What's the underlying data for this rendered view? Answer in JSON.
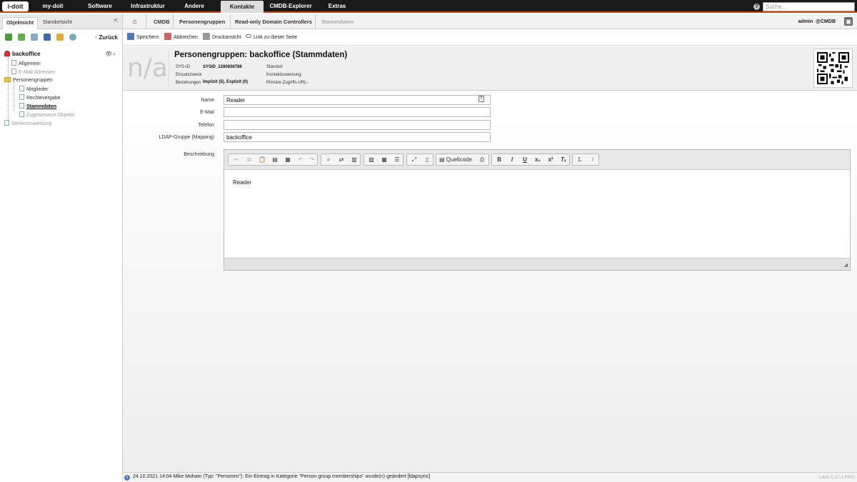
{
  "logo": "i-doit",
  "nav": {
    "items": [
      "my-doit",
      "Software",
      "Infrastruktur",
      "Andere",
      "Kontakte",
      "CMDB-Explorer",
      "Extras"
    ],
    "active": "Kontakte"
  },
  "search": {
    "placeholder": "Suche..."
  },
  "sidebar": {
    "tabs": [
      "Objektsicht",
      "Standortsicht"
    ],
    "back_label": "Zurück",
    "tree": {
      "root": "backoffice",
      "items": [
        "Allgemein",
        "E-Mail Adressen",
        "Personengruppen",
        "Mitglieder",
        "Rechtevergabe",
        "Stammdaten",
        "Zugewiesene Objekte",
        "Servicezuweisung"
      ]
    }
  },
  "breadcrumb": {
    "items": [
      "CMDB",
      "Personengruppen",
      "Read-only Domain Controllers",
      "Stammdaten"
    ]
  },
  "user": {
    "name": "admin",
    "tenant": "@CMDB"
  },
  "actions": [
    "Speichern",
    "Abbrechen",
    "Druckansicht",
    "Link zu dieser Seite"
  ],
  "header": {
    "image_placeholder": "n/a",
    "title": "Personengruppen: backoffice (Stammdaten)",
    "sysid_label": "SYS-ID",
    "sysid_value": "SYSID_1280838788",
    "einsatzzweck_label": "Einsatzzweck",
    "beziehungen_label": "Beziehungen",
    "beziehungen_value": "Implizit (5), Explizit (0)",
    "standort_label": "Standort",
    "kontakt_label": "Kontaktzuweisung",
    "url_label": "Primäre Zugriffs-URL",
    "url_value": "-"
  },
  "form": {
    "name_label": "Name",
    "name_value": "Reader",
    "email_label": "E-Mail",
    "email_value": "",
    "telefon_label": "Telefon",
    "telefon_value": "",
    "ldap_label": "LDAP-Gruppe (Mapping)",
    "ldap_value": "backoffice",
    "beschreibung_label": "Beschreibung",
    "beschreibung_value": "Reader",
    "source_label": "Quellcode"
  },
  "status": {
    "text": "24.10.2021 14:04 Mike Moham (Typ: \"Personen\"): Ein Eintrag in Kategorie \"Person group memberships\" wurde(n) geändert [ldapsync]",
    "version": "i-doit 1.17.1 PRO"
  }
}
